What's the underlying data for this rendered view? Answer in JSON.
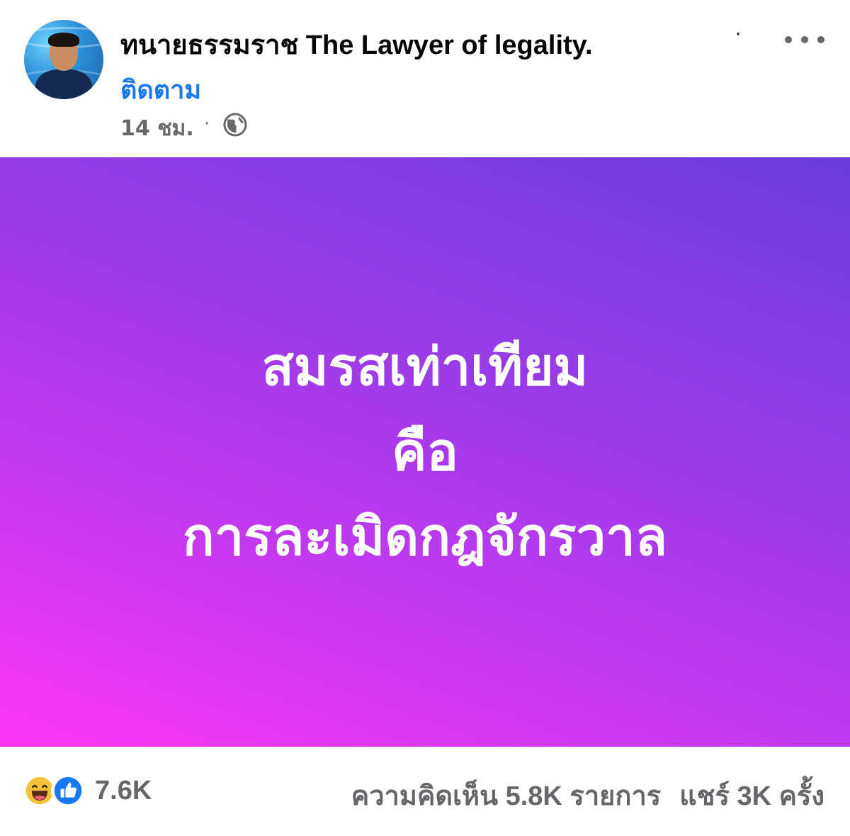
{
  "post": {
    "author": "ทนายธรรมราช The Lawyer of  legality.",
    "name_dot": "·",
    "follow_label": "ติดตาม",
    "timestamp": "14 ชม.",
    "separator": "·",
    "privacy_icon": "globe-icon",
    "more_icon": "more-options-icon",
    "background_colors": [
      "#fb36f6",
      "#6a3ddd"
    ],
    "text_lines": [
      "สมรสเท่าเทียม",
      "คือ",
      "การละเมิดกฎจักรวาล"
    ]
  },
  "footer": {
    "reaction_icons": [
      "haha-icon",
      "like-icon"
    ],
    "reaction_count": "7.6K",
    "comments": "ความคิดเห็น 5.8K รายการ",
    "shares": "แชร์ 3K ครั้ง"
  }
}
